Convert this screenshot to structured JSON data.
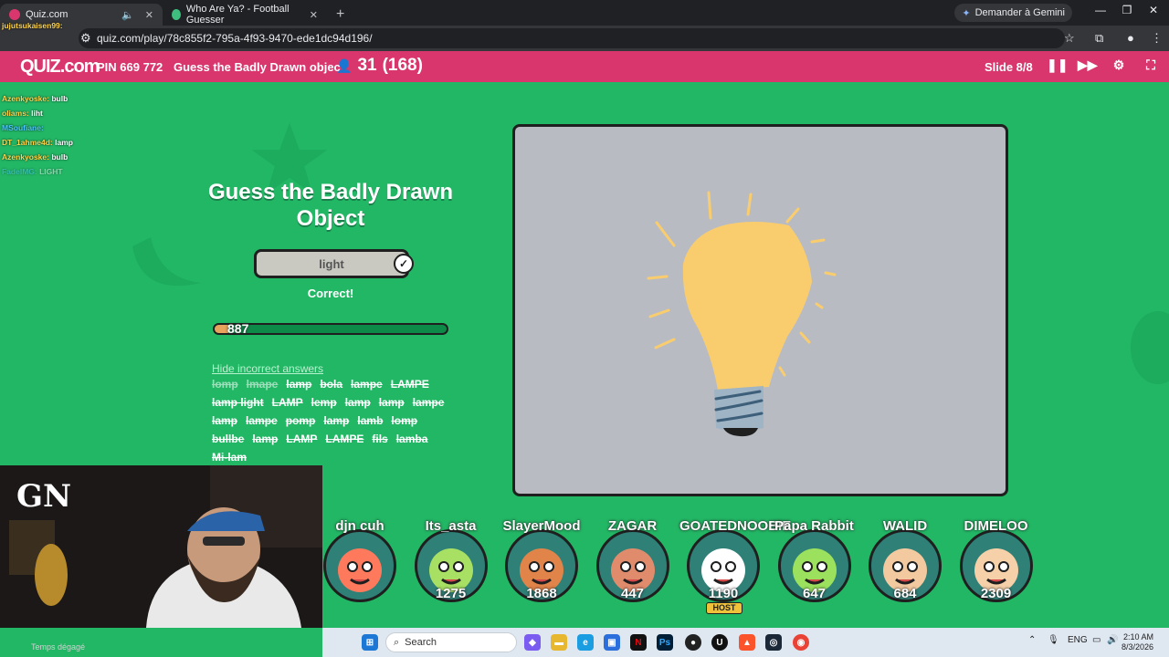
{
  "browser": {
    "tabs": [
      {
        "label": "Quiz.com",
        "active": true
      },
      {
        "label": "Who Are Ya? - Football Guesser",
        "active": false
      }
    ],
    "gemini_label": "Demander à Gemini",
    "url": "quiz.com/play/78c855f2-795a-4f93-9470-ede1dc94d196/"
  },
  "header": {
    "logo": "QUIZ.com",
    "pin": "PIN 669 772",
    "title": "Guess the Badly Drawn objec",
    "players_count": "31",
    "players_total": "(168)",
    "slide": "Slide 8/8"
  },
  "chat": [
    {
      "user": "jujutsukaisen99:",
      "msg": ""
    },
    {
      "user": "Azenkyoske:",
      "msg": "bulb"
    },
    {
      "user": "oliams:",
      "msg": "liht"
    },
    {
      "user": "MSoufiane:",
      "msg": ""
    },
    {
      "user": "DT_1ahme4d:",
      "msg": "lamp"
    },
    {
      "user": "Azenkyoske:",
      "msg": "bulb"
    },
    {
      "user": "FadelMG:",
      "msg": "LIGHT"
    }
  ],
  "question": {
    "title": "Guess the Badly Drawn Object",
    "answer": "light",
    "status": "Correct!",
    "score": "887",
    "progress": 0.06,
    "hide_link": "Hide incorrect answers",
    "incorrect": [
      "lomp",
      "lmape",
      "lamp",
      "bola",
      "lampe",
      "LAMPE",
      "lamp light",
      "LAMP",
      "lemp",
      "lamp",
      "lamp",
      "lampe",
      "lamp",
      "lampe",
      "pomp",
      "lamp",
      "lamb",
      "lomp",
      "bullbe",
      "lamp",
      "LAMP",
      "LAMPE",
      "fils",
      "lamba",
      "Mi-lam"
    ]
  },
  "players": [
    {
      "name": "djn cuh",
      "score": "",
      "color": "#ff7a5c"
    },
    {
      "name": "Its_asta",
      "score": "1275",
      "color": "#a8e063"
    },
    {
      "name": "SlayerMood",
      "score": "1868",
      "color": "#e0844a"
    },
    {
      "name": "ZAGAR",
      "score": "447",
      "color": "#e08c6c"
    },
    {
      "name": "GOATEDNOOBIE",
      "score": "1190",
      "color": "#ffffff",
      "host": "HOST"
    },
    {
      "name": "Papa Rabbit",
      "score": "647",
      "color": "#9be15d"
    },
    {
      "name": "WALID",
      "score": "684",
      "color": "#f3c9a0"
    },
    {
      "name": "DIMELOO",
      "score": "2309",
      "color": "#f5d0a8"
    }
  ],
  "webcam": {
    "logo": "GN",
    "caption": "Temps dégagé"
  },
  "taskbar": {
    "search": "Search",
    "lang": "ENG",
    "time": "2:10 AM",
    "date": "8/3/2026"
  },
  "colors": {
    "page_bg": "#22b765",
    "header_bg": "#d8366d",
    "canvas_bg": "#b9bbc3",
    "bulb": "#f9cd6e"
  }
}
